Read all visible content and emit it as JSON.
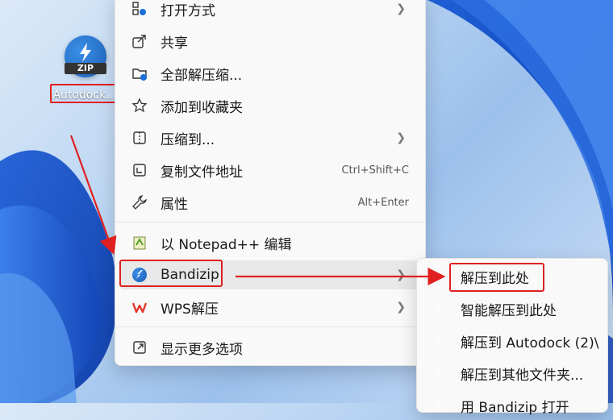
{
  "desktop_icon": {
    "badge": "ZIP",
    "name": "Autodock..."
  },
  "context_menu": {
    "items": [
      {
        "label": "打开方式",
        "shortcut": "",
        "has_submenu": true,
        "icon": "open-with-icon"
      },
      {
        "label": "共享",
        "shortcut": "",
        "has_submenu": false,
        "icon": "share-icon"
      },
      {
        "label": "全部解压缩...",
        "shortcut": "",
        "has_submenu": false,
        "icon": "extract-all-icon"
      },
      {
        "label": "添加到收藏夹",
        "shortcut": "",
        "has_submenu": false,
        "icon": "star-icon"
      },
      {
        "label": "压缩到...",
        "shortcut": "",
        "has_submenu": true,
        "icon": "compress-icon"
      },
      {
        "label": "复制文件地址",
        "shortcut": "Ctrl+Shift+C",
        "has_submenu": false,
        "icon": "copy-path-icon"
      },
      {
        "label": "属性",
        "shortcut": "Alt+Enter",
        "has_submenu": false,
        "icon": "wrench-icon"
      },
      {
        "label": "以 Notepad++ 编辑",
        "shortcut": "",
        "has_submenu": false,
        "icon": "notepad-plus-plus-icon"
      },
      {
        "label": "Bandizip",
        "shortcut": "",
        "has_submenu": true,
        "icon": "bandizip-icon"
      },
      {
        "label": "WPS解压",
        "shortcut": "",
        "has_submenu": true,
        "icon": "wps-icon"
      },
      {
        "label": "显示更多选项",
        "shortcut": "",
        "has_submenu": false,
        "icon": "more-options-icon"
      }
    ]
  },
  "bandizip_submenu": {
    "items": [
      {
        "label": "解压到此处"
      },
      {
        "label": "智能解压到此处"
      },
      {
        "label": "解压到 Autodock (2)\\"
      },
      {
        "label": "解压到其他文件夹..."
      },
      {
        "label": "用 Bandizip 打开"
      }
    ]
  },
  "colors": {
    "highlight_border": "#e02020",
    "accent": "#1c5fb8"
  }
}
